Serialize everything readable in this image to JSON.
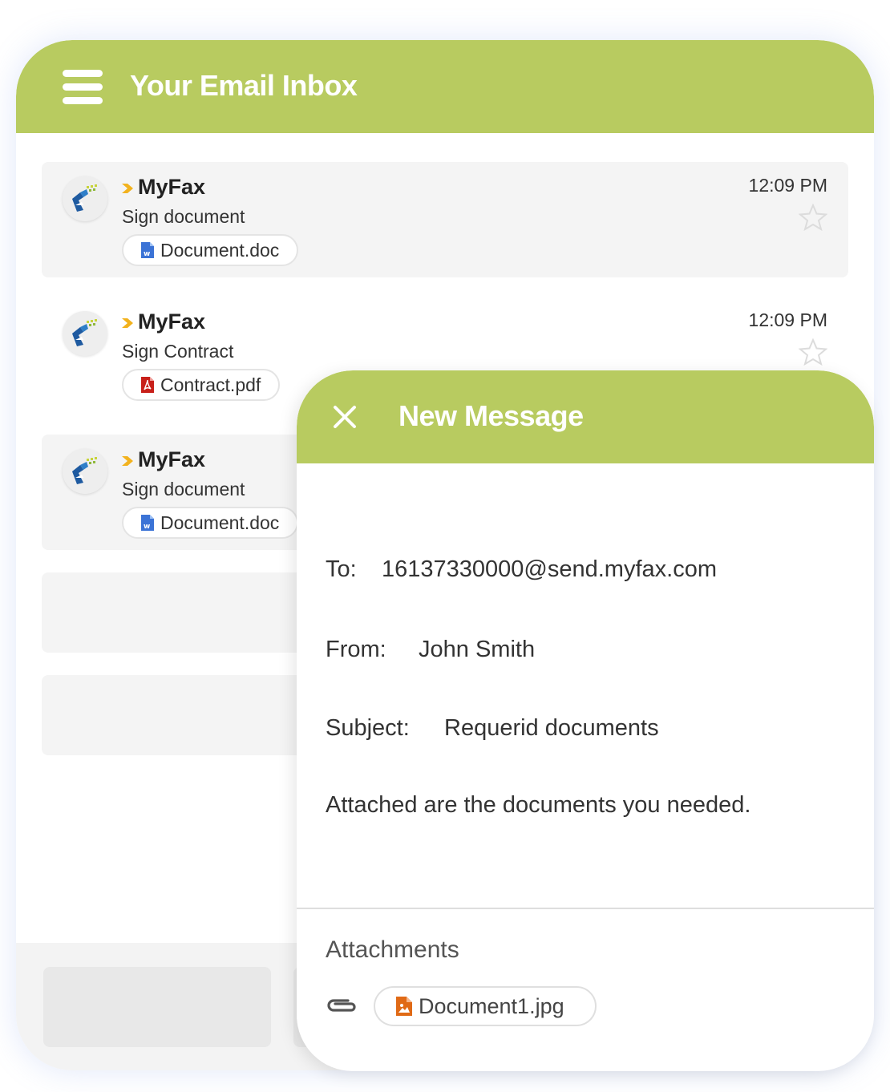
{
  "inbox": {
    "title": "Your Email Inbox",
    "messages": [
      {
        "sender": "MyFax",
        "subject": "Sign document",
        "attachment": "Document.doc",
        "attachment_type": "word-doc-icon",
        "time": "12:09 PM"
      },
      {
        "sender": "MyFax",
        "subject": "Sign Contract",
        "attachment": "Contract.pdf",
        "attachment_type": "pdf-icon",
        "time": "12:09 PM"
      },
      {
        "sender": "MyFax",
        "subject": "Sign document",
        "attachment": "Document.doc",
        "attachment_type": "word-doc-icon",
        "time": ""
      }
    ]
  },
  "compose": {
    "title": "New Message",
    "to_label": "To:",
    "to_value": "16137330000@send.myfax.com",
    "from_label": "From:",
    "from_value": "John Smith",
    "subject_label": "Subject:",
    "subject_value": "Requerid documents",
    "body": "Attached are the documents you needed.",
    "attachments_title": "Attachments",
    "attachments": [
      {
        "name": "Document1.jpg",
        "icon": "image-file-icon"
      }
    ]
  },
  "colors": {
    "header_green": "#b8cb60",
    "sender_arrow": "#f2b21e",
    "pdf_red": "#c8201a",
    "word_blue": "#3b73d6",
    "image_orange": "#e06a16"
  }
}
